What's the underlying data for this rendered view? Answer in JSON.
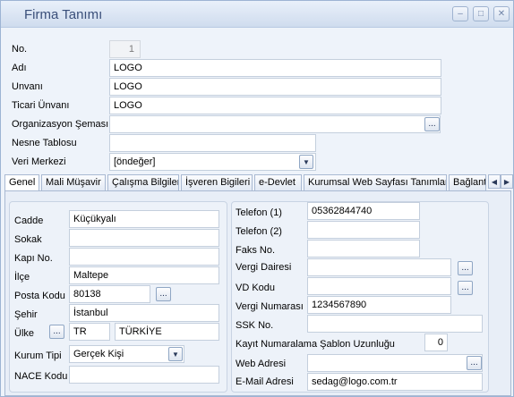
{
  "window": {
    "title": "Firma Tanımı",
    "controls": {
      "minimize": "–",
      "maximize": "□",
      "close": "✕"
    }
  },
  "header": {
    "no_label": "No.",
    "no_value": "1",
    "adi_label": "Adı",
    "adi_value": "LOGO",
    "unvani_label": "Unvanı",
    "unvani_value": "LOGO",
    "ticari_label": "Ticari Ünvanı",
    "ticari_value": "LOGO",
    "org_label": "Organizasyon Şeması",
    "org_value": "",
    "nesne_label": "Nesne Tablosu",
    "nesne_value": "",
    "veri_label": "Veri Merkezi",
    "veri_value": "[öndeğer]"
  },
  "tabs": [
    "Genel",
    "Mali Müşavir",
    "Çalışma Bilgileri",
    "İşveren Bigileri",
    "e-Devlet",
    "Kurumsal Web Sayfası Tanımları",
    "Bağlantı"
  ],
  "tab_nav": {
    "prev": "◀",
    "next": "▶"
  },
  "address": {
    "cadde_label": "Cadde",
    "cadde_value": "Küçükyalı",
    "sokak_label": "Sokak",
    "sokak_value": "",
    "kapi_label": "Kapı No.",
    "kapi_value": "",
    "ilce_label": "İlçe",
    "ilce_value": "Maltepe",
    "posta_label": "Posta Kodu",
    "posta_value": "80138",
    "sehir_label": "Şehir",
    "sehir_value": "İstanbul",
    "ulke_label": "Ülke",
    "ulke_code": "TR",
    "ulke_name": "TÜRKİYE",
    "kurum_label": "Kurum Tipi",
    "kurum_value": "Gerçek Kişi",
    "nace_label": "NACE Kodu",
    "nace_value": ""
  },
  "contact": {
    "tel1_label": "Telefon (1)",
    "tel1_value": "05362844740",
    "tel2_label": "Telefon (2)",
    "tel2_value": "",
    "faks_label": "Faks No.",
    "faks_value": "",
    "vd_label": "Vergi Dairesi",
    "vd_value": "",
    "vdkod_label": "VD Kodu",
    "vdkod_value": "",
    "vno_label": "Vergi Numarası",
    "vno_value": "1234567890",
    "ssk_label": "SSK No.",
    "ssk_value": "",
    "kayit_label": "Kayıt Numaralama Şablon Uzunluğu",
    "kayit_value": "0",
    "web_label": "Web Adresi",
    "web_value": "",
    "email_label": "E-Mail Adresi",
    "email_value": "sedag@logo.com.tr"
  },
  "button_text": {
    "dots": "...",
    "dropdown": "▼"
  }
}
